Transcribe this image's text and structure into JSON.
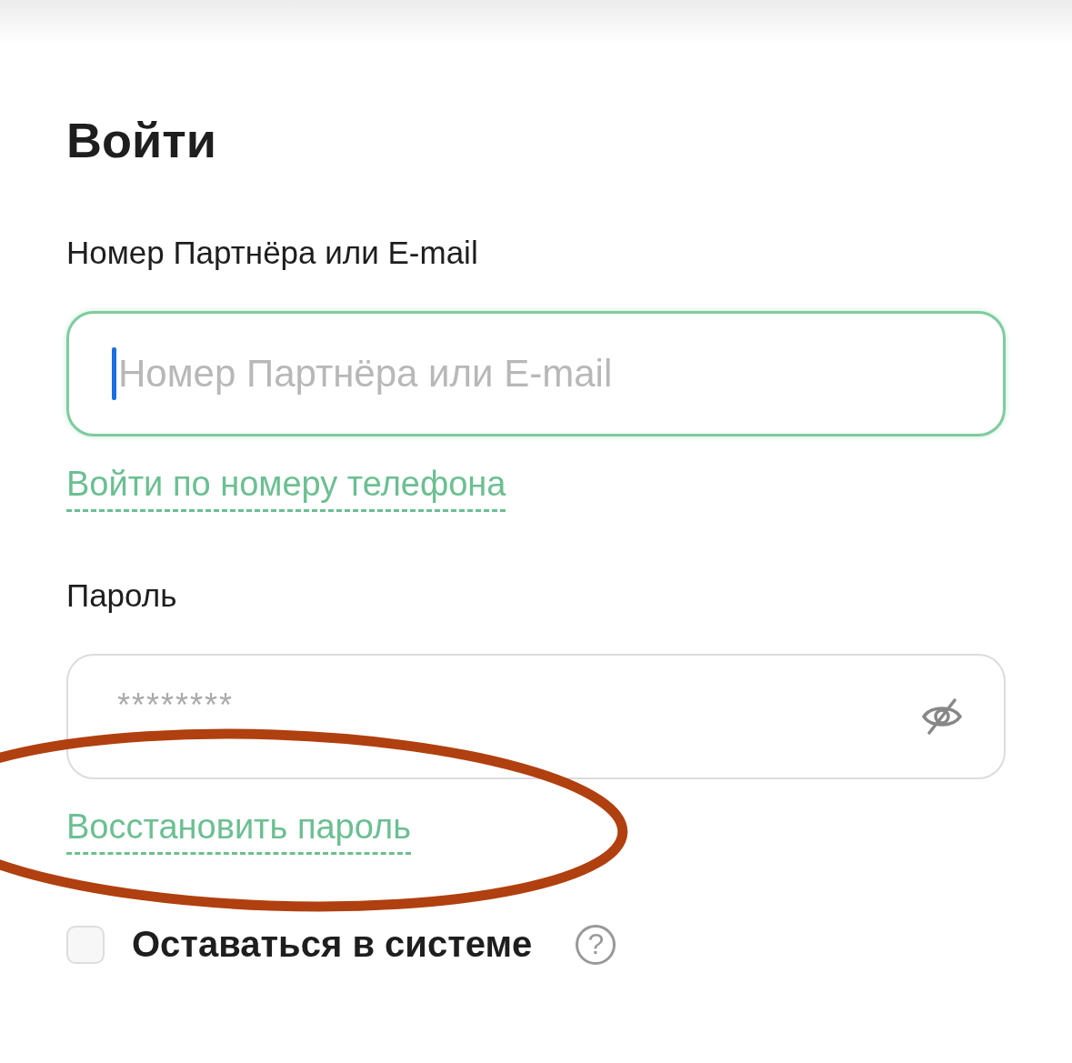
{
  "title": "Войти",
  "fields": [
    {
      "label": "Номер Партнёра или E-mail",
      "placeholder": "Номер Партнёра или E-mail",
      "focused": true,
      "kind": "text",
      "link": "Войти по номеру телефона"
    },
    {
      "label": "Пароль",
      "placeholder": "********",
      "focused": false,
      "kind": "password",
      "link": "Восстановить пароль"
    }
  ],
  "remember": {
    "label": "Оставаться в системе",
    "checked": false,
    "help": "?"
  },
  "annotations": [
    {
      "kind": "ellipse"
    }
  ]
}
